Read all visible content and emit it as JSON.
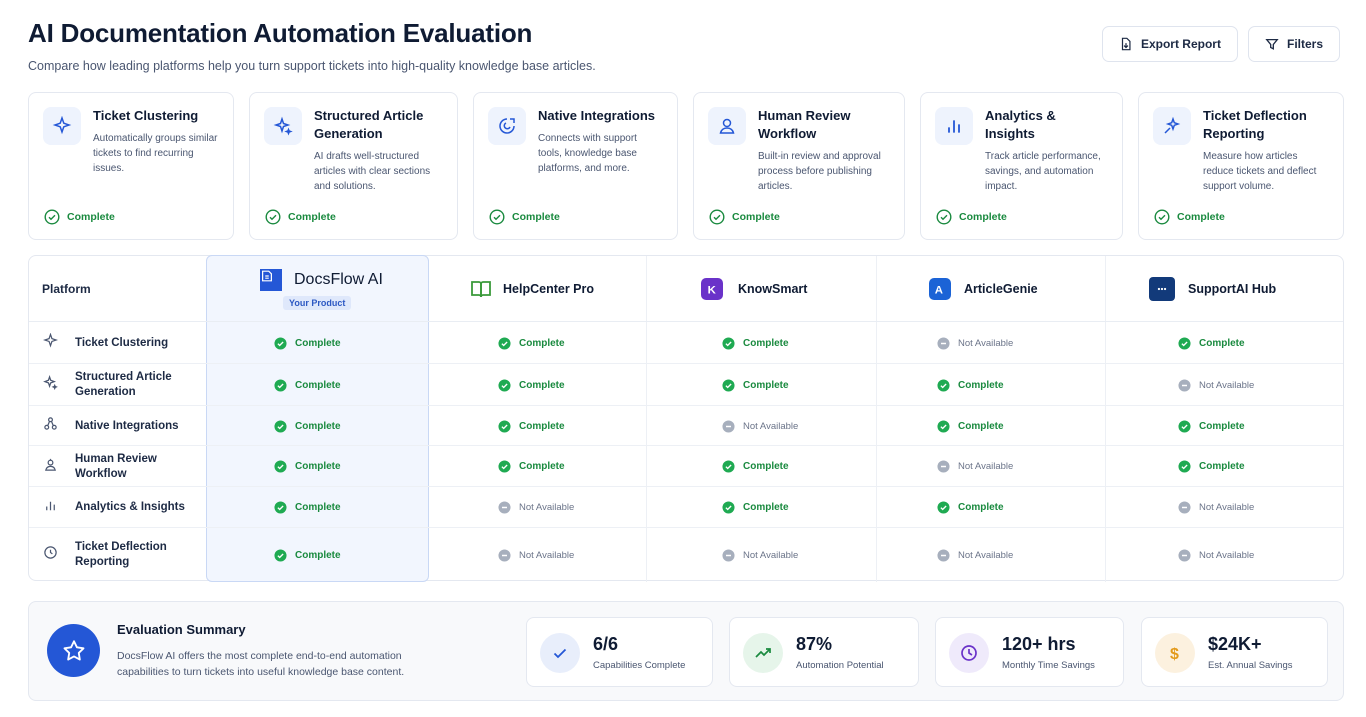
{
  "header": {
    "title": "AI Documentation Automation Evaluation",
    "subtitle": "Compare how leading platforms help you turn support tickets into high-quality knowledge base articles."
  },
  "actions": {
    "export_label": "Export Report",
    "filters_label": "Filters"
  },
  "feature_cards": [
    {
      "title": "Ticket Clustering",
      "desc": "Automatically groups similar tickets to find recurring issues.",
      "status": "Complete",
      "icon": "sparkle-icon"
    },
    {
      "title": "Structured Article Generation",
      "desc": "AI drafts well-structured articles with clear sections and solutions.",
      "status": "Complete",
      "icon": "magic-sparkle-icon"
    },
    {
      "title": "Native Integrations",
      "desc": "Connects with support tools, knowledge base platforms, and more.",
      "status": "Complete",
      "icon": "integration-icon"
    },
    {
      "title": "Human Review Workflow",
      "desc": "Built-in review and approval process before publishing articles.",
      "status": "Complete",
      "icon": "user-icon"
    },
    {
      "title": "Analytics & Insights",
      "desc": "Track article performance, savings, and automation impact.",
      "status": "Complete",
      "icon": "bar-chart-icon"
    },
    {
      "title": "Ticket Deflection Reporting",
      "desc": "Measure how articles reduce tickets and deflect support volume.",
      "status": "Complete",
      "icon": "deflection-icon"
    }
  ],
  "matrix": {
    "platform_label": "Platform",
    "your_product_label": "Your Product",
    "vendors": [
      "DocsFlow AI",
      "HelpCenter Pro",
      "KnowSmart",
      "ArticleGenie",
      "SupportAI Hub"
    ],
    "complete_label": "Complete",
    "na_label": "Not Available",
    "rows": [
      {
        "feature": "Ticket Clustering",
        "values": [
          "Complete",
          "Complete",
          "Complete",
          "Not Available",
          "Complete"
        ]
      },
      {
        "feature": "Structured Article Generation",
        "values": [
          "Complete",
          "Complete",
          "Complete",
          "Complete",
          "Not Available"
        ]
      },
      {
        "feature": "Native Integrations",
        "values": [
          "Complete",
          "Complete",
          "Not Available",
          "Complete",
          "Complete"
        ]
      },
      {
        "feature": "Human Review Workflow",
        "values": [
          "Complete",
          "Complete",
          "Complete",
          "Not Available",
          "Complete"
        ]
      },
      {
        "feature": "Analytics & Insights",
        "values": [
          "Complete",
          "Not Available",
          "Complete",
          "Complete",
          "Not Available"
        ]
      },
      {
        "feature": "Ticket Deflection Reporting",
        "values": [
          "Complete",
          "Not Available",
          "Not Available",
          "Not Available",
          "Not Available"
        ]
      }
    ]
  },
  "summary": {
    "title": "Evaluation Summary",
    "text": "DocsFlow AI offers the most complete end-to-end automation capabilities to turn tickets into useful knowledge base content.",
    "stats": [
      {
        "value": "6/6",
        "label": "Capabilities Complete",
        "icon": "check-icon"
      },
      {
        "value": "87%",
        "label": "Automation Potential",
        "icon": "trend-up-icon"
      },
      {
        "value": "120+ hrs",
        "label": "Monthly Time Savings",
        "icon": "clock-icon"
      },
      {
        "value": "$24K+",
        "label": "Est. Annual Savings",
        "icon": "dollar-icon"
      }
    ]
  },
  "colors": {
    "accent": "#2457d6",
    "complete": "#1a8a3f",
    "na": "#6b7489"
  }
}
